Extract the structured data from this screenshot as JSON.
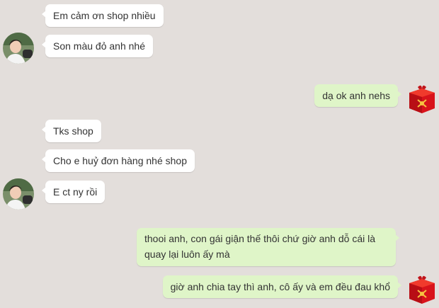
{
  "chat": {
    "messages": [
      {
        "sender": "customer",
        "text": "Em cảm ơn shop nhiều"
      },
      {
        "sender": "customer",
        "text": "Son màu đỏ anh nhé"
      },
      {
        "sender": "shop",
        "text": "dạ ok anh nehs"
      },
      {
        "sender": "customer",
        "text": "Tks shop"
      },
      {
        "sender": "customer",
        "text": "Cho e huỷ đơn hàng nhé shop"
      },
      {
        "sender": "customer",
        "text": "E ct ny rồi"
      },
      {
        "sender": "shop",
        "text": "thooi anh, con gái giận thế thôi chứ giờ anh dỗ cái là quay lại luôn ấy mà"
      },
      {
        "sender": "shop",
        "text": "giờ anh chia tay thì anh, cô ấy và em đều đau khổ"
      }
    ]
  },
  "colors": {
    "background": "#e3dedb",
    "incoming_bubble": "#ffffff",
    "outgoing_bubble": "#dff5c8",
    "text": "#333333"
  },
  "icons": {
    "customer_avatar": "customer-avatar-photo",
    "shop_avatar": "red-gift-box-icon"
  }
}
